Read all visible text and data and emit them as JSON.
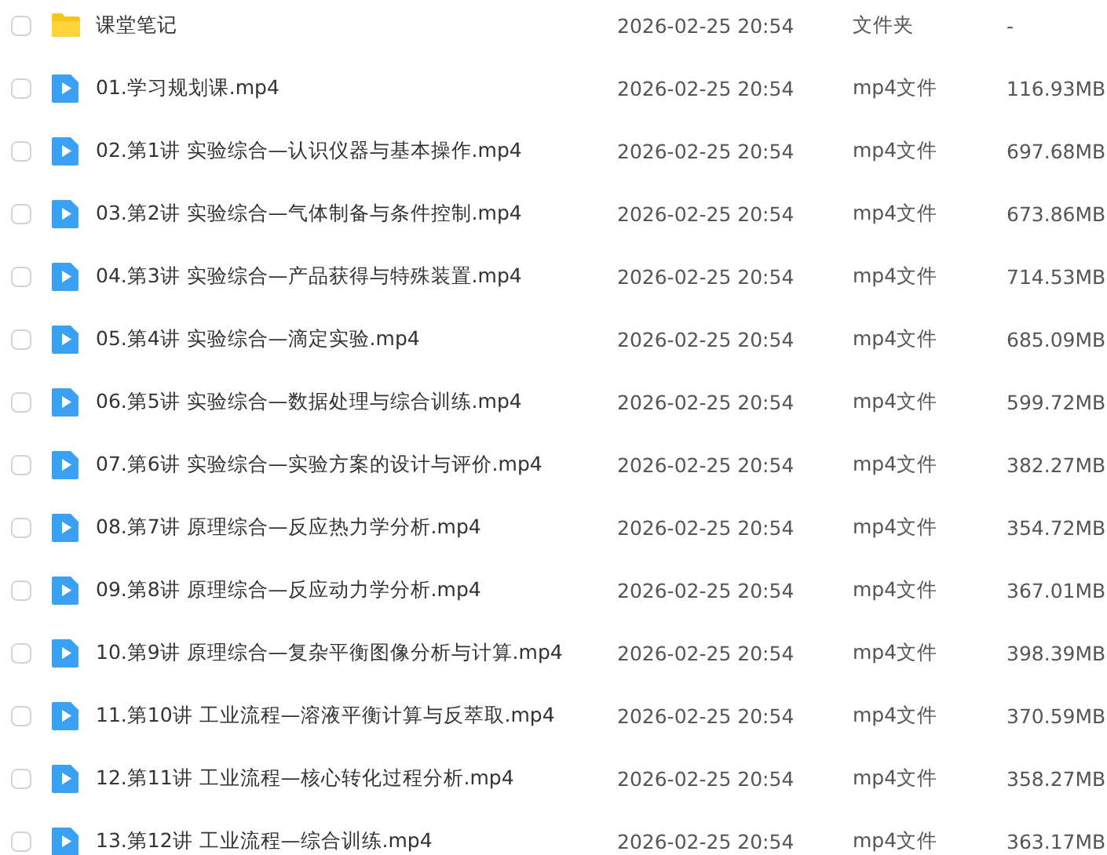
{
  "files": [
    {
      "kind": "folder",
      "checked": false,
      "name": "课堂笔记",
      "modified": "2026-02-25 20:54",
      "type": "文件夹",
      "size": "-"
    },
    {
      "kind": "video",
      "checked": false,
      "name": "01.学习规划课.mp4",
      "modified": "2026-02-25 20:54",
      "type": "mp4文件",
      "size": "116.93MB"
    },
    {
      "kind": "video",
      "checked": false,
      "name": "02.第1讲 实验综合—认识仪器与基本操作.mp4",
      "modified": "2026-02-25 20:54",
      "type": "mp4文件",
      "size": "697.68MB"
    },
    {
      "kind": "video",
      "checked": false,
      "name": "03.第2讲 实验综合—气体制备与条件控制.mp4",
      "modified": "2026-02-25 20:54",
      "type": "mp4文件",
      "size": "673.86MB"
    },
    {
      "kind": "video",
      "checked": false,
      "name": "04.第3讲 实验综合—产品获得与特殊装置.mp4",
      "modified": "2026-02-25 20:54",
      "type": "mp4文件",
      "size": "714.53MB"
    },
    {
      "kind": "video",
      "checked": false,
      "name": "05.第4讲 实验综合—滴定实验.mp4",
      "modified": "2026-02-25 20:54",
      "type": "mp4文件",
      "size": "685.09MB"
    },
    {
      "kind": "video",
      "checked": false,
      "name": "06.第5讲 实验综合—数据处理与综合训练.mp4",
      "modified": "2026-02-25 20:54",
      "type": "mp4文件",
      "size": "599.72MB"
    },
    {
      "kind": "video",
      "checked": false,
      "name": "07.第6讲 实验综合—实验方案的设计与评价.mp4",
      "modified": "2026-02-25 20:54",
      "type": "mp4文件",
      "size": "382.27MB"
    },
    {
      "kind": "video",
      "checked": false,
      "name": "08.第7讲 原理综合—反应热力学分析.mp4",
      "modified": "2026-02-25 20:54",
      "type": "mp4文件",
      "size": "354.72MB"
    },
    {
      "kind": "video",
      "checked": false,
      "name": "09.第8讲 原理综合—反应动力学分析.mp4",
      "modified": "2026-02-25 20:54",
      "type": "mp4文件",
      "size": "367.01MB"
    },
    {
      "kind": "video",
      "checked": false,
      "name": "10.第9讲 原理综合—复杂平衡图像分析与计算.mp4",
      "modified": "2026-02-25 20:54",
      "type": "mp4文件",
      "size": "398.39MB"
    },
    {
      "kind": "video",
      "checked": false,
      "name": "11.第10讲 工业流程—溶液平衡计算与反萃取.mp4",
      "modified": "2026-02-25 20:54",
      "type": "mp4文件",
      "size": "370.59MB"
    },
    {
      "kind": "video",
      "checked": false,
      "name": "12.第11讲 工业流程—核心转化过程分析.mp4",
      "modified": "2026-02-25 20:54",
      "type": "mp4文件",
      "size": "358.27MB"
    },
    {
      "kind": "video",
      "checked": false,
      "name": "13.第12讲 工业流程—综合训练.mp4",
      "modified": "2026-02-25 20:54",
      "type": "mp4文件",
      "size": "363.17MB"
    }
  ]
}
